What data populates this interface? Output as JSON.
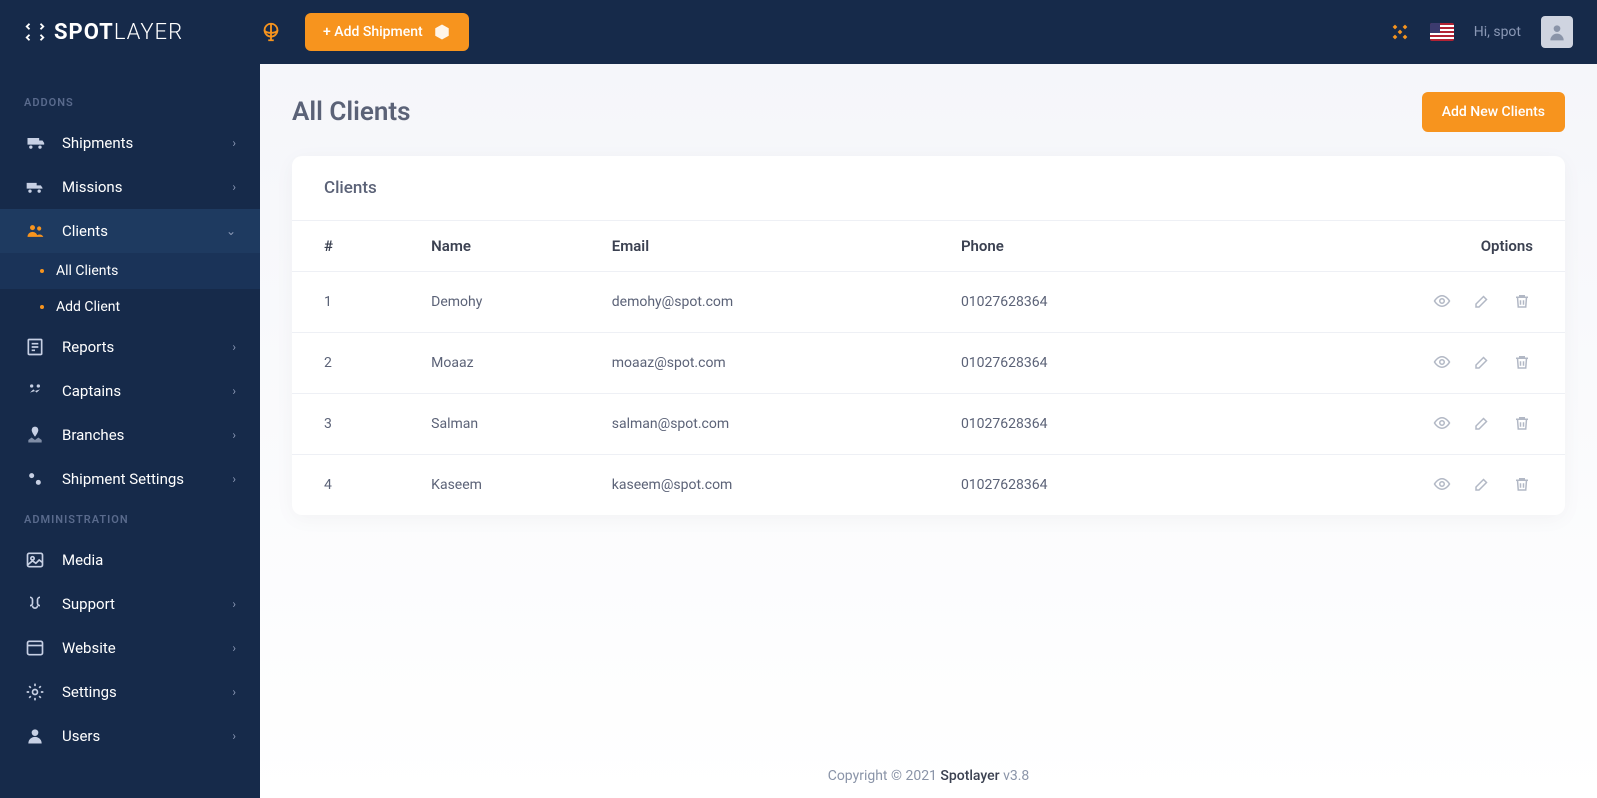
{
  "brand": {
    "part1": "SPOT",
    "part2": "LAYER"
  },
  "topbar": {
    "add_shipment_label": "+ Add Shipment",
    "greeting_prefix": "Hi, ",
    "user_name": "spot"
  },
  "sidebar": {
    "sections": {
      "addons": "ADDONS",
      "administration": "ADMINISTRATION"
    },
    "items": {
      "shipments": "Shipments",
      "missions": "Missions",
      "clients": "Clients",
      "reports": "Reports",
      "captains": "Captains",
      "branches": "Branches",
      "shipment_settings": "Shipment Settings",
      "media": "Media",
      "support": "Support",
      "website": "Website",
      "settings": "Settings",
      "users": "Users"
    },
    "sub_clients": {
      "all_clients": "All Clients",
      "add_client": "Add Client"
    }
  },
  "page": {
    "title": "All Clients",
    "add_new_label": "Add New Clients",
    "card_title": "Clients"
  },
  "table": {
    "headers": {
      "num": "#",
      "name": "Name",
      "email": "Email",
      "phone": "Phone",
      "options": "Options"
    },
    "rows": [
      {
        "num": "1",
        "name": "Demohy",
        "email": "demohy@spot.com",
        "phone": "01027628364"
      },
      {
        "num": "2",
        "name": "Moaaz",
        "email": "moaaz@spot.com",
        "phone": "01027628364"
      },
      {
        "num": "3",
        "name": "Salman",
        "email": "salman@spot.com",
        "phone": "01027628364"
      },
      {
        "num": "4",
        "name": "Kaseem",
        "email": "kaseem@spot.com",
        "phone": "01027628364"
      }
    ]
  },
  "footer": {
    "copyright": "Copyright © 2021 ",
    "brand": "Spotlayer",
    "version": " v3.8"
  }
}
